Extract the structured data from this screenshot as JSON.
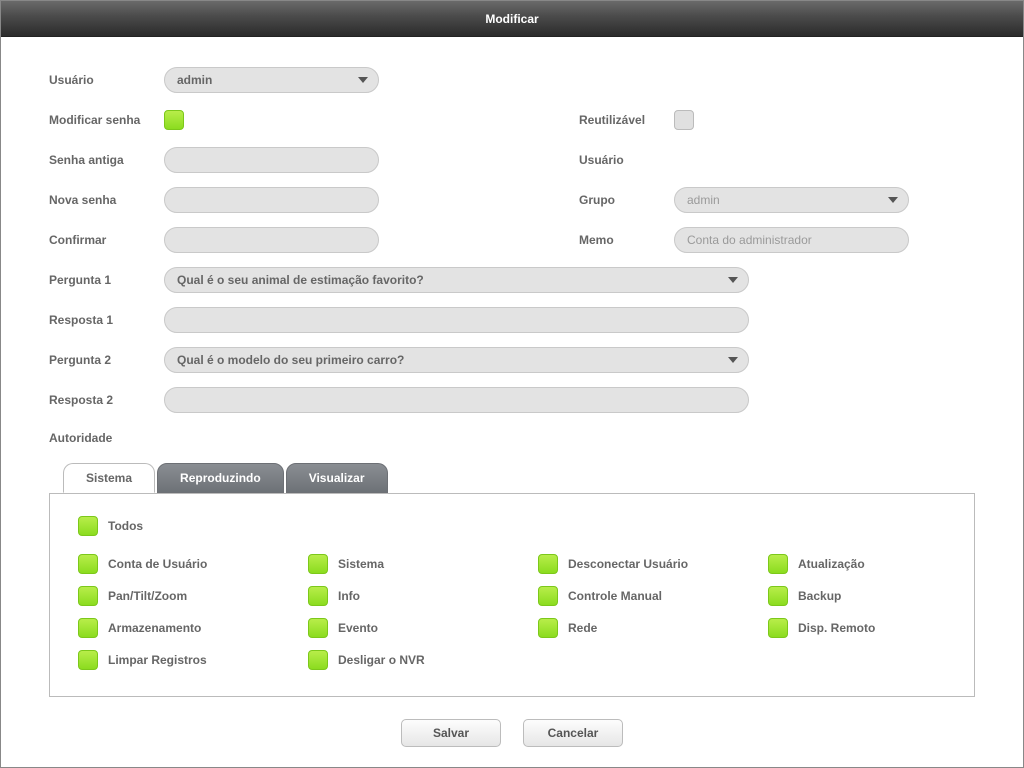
{
  "title": "Modificar",
  "labels": {
    "usuario": "Usuário",
    "modificar_senha": "Modificar senha",
    "senha_antiga": "Senha antiga",
    "nova_senha": "Nova senha",
    "confirmar": "Confirmar",
    "reutilizavel": "Reutilizável",
    "usuario_r": "Usuário",
    "grupo": "Grupo",
    "memo": "Memo",
    "pergunta1": "Pergunta 1",
    "resposta1": "Resposta 1",
    "pergunta2": "Pergunta 2",
    "resposta2": "Resposta 2",
    "autoridade": "Autoridade"
  },
  "values": {
    "usuario_select": "admin",
    "grupo_select": "admin",
    "memo_placeholder": "Conta do administrador",
    "pergunta1_select": "Qual é o seu animal de estimação favorito?",
    "pergunta2_select": "Qual é o modelo do seu primeiro carro?",
    "modificar_senha_checked": true,
    "reutilizavel_checked": false
  },
  "tabs": {
    "sistema": "Sistema",
    "reproduzindo": "Reproduzindo",
    "visualizar": "Visualizar"
  },
  "permissions": {
    "todos": "Todos",
    "items": [
      "Conta de Usuário",
      "Sistema",
      "Desconectar Usuário",
      "Atualização",
      "Pan/Tilt/Zoom",
      "Info",
      "Controle Manual",
      "Backup",
      "Armazenamento",
      "Evento",
      "Rede",
      "Disp. Remoto",
      "Limpar Registros",
      "Desligar o NVR"
    ]
  },
  "buttons": {
    "salvar": "Salvar",
    "cancelar": "Cancelar"
  }
}
